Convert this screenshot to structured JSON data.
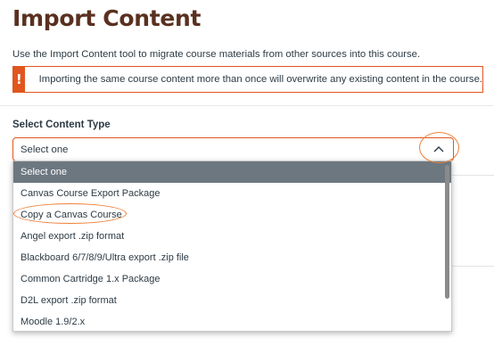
{
  "page": {
    "title": "Import Content",
    "intro": "Use the Import Content tool to migrate course materials from other sources into this course."
  },
  "alert": {
    "icon": "exclamation-icon",
    "icon_glyph": "!",
    "text": "Importing the same course content more than once will overwrite any existing content in the course.",
    "color": "#e0561e"
  },
  "content_type": {
    "label": "Select Content Type",
    "selected_value": "Select one",
    "expanded": true,
    "options": [
      "Select one",
      "Canvas Course Export Package",
      "Copy a Canvas Course",
      "Angel export .zip format",
      "Blackboard 6/7/8/9/Ultra export .zip file",
      "Common Cartridge 1.x Package",
      "D2L export .zip format",
      "Moodle 1.9/2.x"
    ],
    "highlighted_option": "Select one"
  },
  "colors": {
    "title": "#5a3020",
    "accent": "#e0561e",
    "annotation": "#ee8038",
    "selected_option_bg": "#6c7780"
  }
}
